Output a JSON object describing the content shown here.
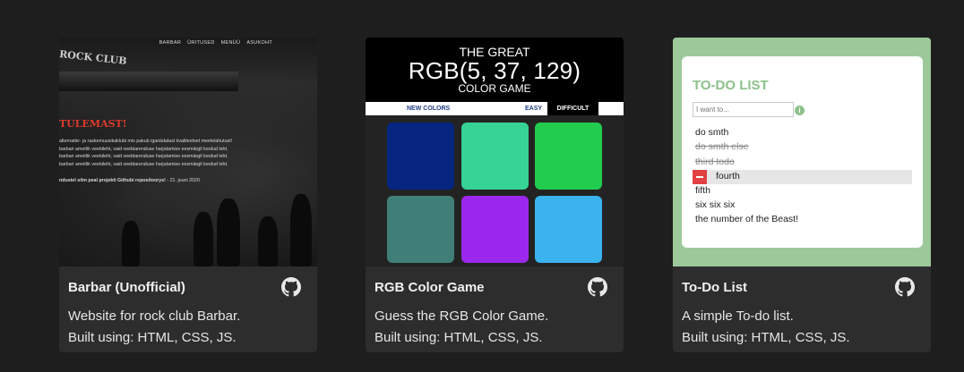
{
  "cards": [
    {
      "title": "Barbar (Unofficial)",
      "description_line1": "Website for rock club Barbar.",
      "description_line2": "Built using: HTML, CSS, JS.",
      "screenshot": {
        "nav": [
          "BARBAR",
          "ÜRITUSED",
          "MENÜÜ",
          "ASUKOHT"
        ],
        "club_sign": "ROCK CLUB",
        "headline": "TULEMAST!",
        "paragraph_lines": [
          "alternatiiv- ja raskemuusikaklubi mis pakub iganädalast kvaliteetset meelelahutust!",
          "barbari ametlik veebileht, vaid veebiarenduse harjutamise eesmärgil loodud leht.",
          "barbari ametlik veebileht, vaid veebiarenduse harjutamise eesmärgil loodud leht.",
          "barbari ametlik veebileht, vaid veebiarenduse harjutamise eesmärgil loodud leht."
        ],
        "footer_bold": "ndustel silm peal projekti Githubi repositoorys!",
        "footer_date": " - 21. juuni 2020"
      }
    },
    {
      "title": "RGB Color Game",
      "description_line1": "Guess the RGB Color Game.",
      "description_line2": "Built using: HTML, CSS, JS.",
      "screenshot": {
        "line1": "THE GREAT",
        "line2": "RGB(5, 37, 129)",
        "line3": "COLOR GAME",
        "new_colors": "NEW COLORS",
        "easy": "EASY",
        "difficult": "DIFFICULT",
        "squares": [
          "#052581",
          "#37d295",
          "#22cc4e",
          "#3f7f77",
          "#9c28ee",
          "#3ab3ef"
        ]
      }
    },
    {
      "title": "To-Do List",
      "description_line1": "A simple To-do list.",
      "description_line2": "Built using: HTML, CSS, JS.",
      "screenshot": {
        "heading": "TO-DO LIST",
        "input_placeholder": "I want to...",
        "info_icon": "i",
        "items": [
          {
            "text": "do smth",
            "done": false
          },
          {
            "text": "do smth else",
            "done": true
          },
          {
            "text": "third todo",
            "done": true
          },
          {
            "text": "fourth",
            "done": false
          },
          {
            "text": "fifth",
            "done": false
          },
          {
            "text": "six six six",
            "done": false
          },
          {
            "text": "the number of the Beast!",
            "done": false
          }
        ]
      }
    }
  ],
  "colors": {
    "page_bg": "#1e1e1e",
    "card_bg": "#2d2d2d",
    "todo_green": "#8cc18b",
    "headline_red": "#e03a2c"
  },
  "icons": {
    "github": "github-icon"
  }
}
